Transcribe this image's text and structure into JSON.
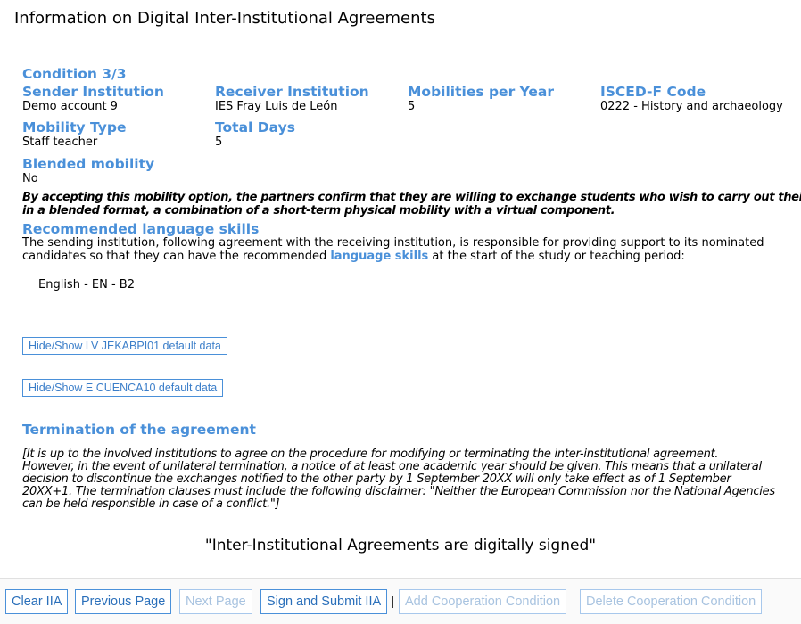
{
  "page": {
    "title": "Information on Digital Inter-Institutional Agreements"
  },
  "condition": {
    "heading": "Condition 3/3",
    "sender_label": "Sender Institution",
    "sender_value": "Demo account 9",
    "receiver_label": "Receiver Institution",
    "receiver_value": "IES Fray Luis de León",
    "mobilities_label": "Mobilities per Year",
    "mobilities_value": "5",
    "isced_label": "ISCED-F Code",
    "isced_value": "0222 - History and archaeology",
    "mobility_type_label": "Mobility Type",
    "mobility_type_value": "Staff teacher",
    "total_days_label": "Total Days",
    "total_days_value": "5",
    "blended_label": "Blended mobility",
    "blended_value": "No",
    "blended_note_line1": "By accepting this mobility option, the partners confirm that they are willing to exchange students who wish to carry out their mobility",
    "blended_note_line2": "in a blended format, a combination of a short-term physical mobility with a virtual component."
  },
  "language": {
    "heading": "Recommended language skills",
    "para_before": "The sending institution, following agreement with the receiving institution, is responsible for providing support to its nominated candidates so that they can have the recommended ",
    "link_text": "language skills",
    "para_after": " at the start of the study or teaching period:",
    "items": [
      "English - EN - B2"
    ]
  },
  "toggles": {
    "lv_label": "Hide/Show LV JEKABPI01 default data",
    "e_label": "Hide/Show E CUENCA10 default data"
  },
  "termination": {
    "heading": "Termination of the agreement",
    "lines": [
      "[It is up to the involved institutions to agree on the procedure for modifying or terminating the inter-institutional agreement.",
      "However, in the event of unilateral termination, a notice of at least one academic year should be given. This means that a unilateral",
      "decision to discontinue the exchanges notified to the other party by 1 September 20XX will only take effect as of 1 September",
      "20XX+1. The termination clauses must include the following disclaimer: \"Neither the European Commission nor the National Agencies",
      "can be held responsible in case of a conflict.\"]"
    ]
  },
  "signed_text": "\"Inter-Institutional Agreements are digitally signed\"",
  "footer": {
    "clear": "Clear IIA",
    "previous": "Previous Page",
    "next": "Next Page",
    "sign": "Sign and Submit IIA",
    "add": "Add Cooperation Condition",
    "delete": "Delete Cooperation Condition"
  },
  "colors": {
    "accent": "#4a90d9",
    "disabled": "#a8c3e0"
  }
}
